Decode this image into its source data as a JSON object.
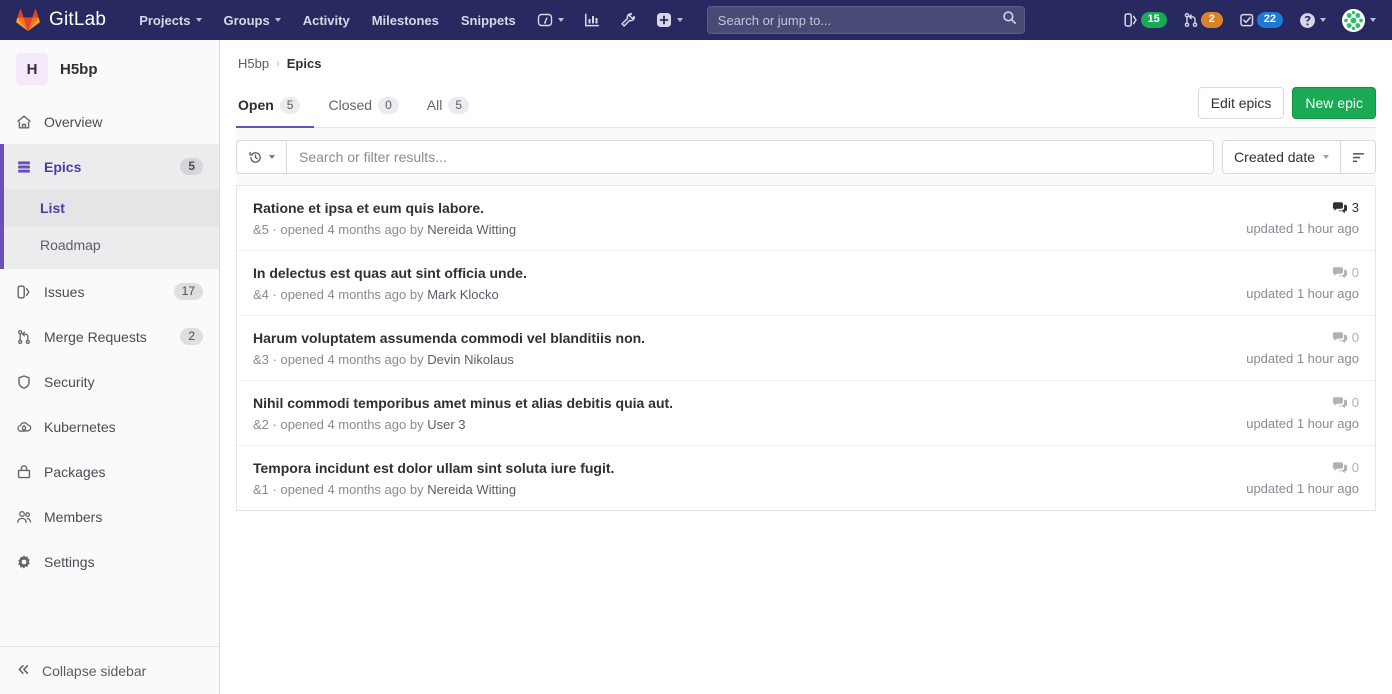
{
  "navbar": {
    "brand": "GitLab",
    "links": [
      {
        "label": "Projects",
        "has_caret": true
      },
      {
        "label": "Groups",
        "has_caret": true
      },
      {
        "label": "Activity",
        "has_caret": false
      },
      {
        "label": "Milestones",
        "has_caret": false
      },
      {
        "label": "Snippets",
        "has_caret": false
      }
    ],
    "icon_buttons": [
      {
        "name": "dashboard-icon",
        "has_caret": true
      },
      {
        "name": "analytics-icon",
        "has_caret": false
      },
      {
        "name": "admin-wrench-icon",
        "has_caret": false
      }
    ],
    "create_new": {
      "name": "plus-square-icon",
      "has_caret": true
    },
    "search": {
      "placeholder": "Search or jump to...",
      "value": ""
    },
    "counters": [
      {
        "name": "issues-counter",
        "icon": "issues-icon",
        "count": "15",
        "color": "#1aaa55"
      },
      {
        "name": "merge-requests-counter",
        "icon": "merge-request-icon",
        "count": "2",
        "color": "#d9822b"
      },
      {
        "name": "todos-counter",
        "icon": "todo-check-icon",
        "count": "22",
        "color": "#1f78d1"
      }
    ],
    "help": {
      "name": "help-icon"
    },
    "user": {
      "name": "user-avatar"
    }
  },
  "sidebar": {
    "group": {
      "initial": "H",
      "name": "H5bp"
    },
    "items": [
      {
        "label": "Overview",
        "icon": "home-icon",
        "count": "",
        "active": false
      },
      {
        "label": "Epics",
        "icon": "epic-icon",
        "count": "5",
        "active": true
      },
      {
        "label": "Issues",
        "icon": "issues-icon",
        "count": "17",
        "active": false
      },
      {
        "label": "Merge Requests",
        "icon": "merge-request-icon",
        "count": "2",
        "active": false
      },
      {
        "label": "Security",
        "icon": "shield-icon",
        "count": "",
        "active": false
      },
      {
        "label": "Kubernetes",
        "icon": "kubernetes-icon",
        "count": "",
        "active": false
      },
      {
        "label": "Packages",
        "icon": "package-icon",
        "count": "",
        "active": false
      },
      {
        "label": "Members",
        "icon": "members-icon",
        "count": "",
        "active": false
      },
      {
        "label": "Settings",
        "icon": "gear-icon",
        "count": "",
        "active": false
      }
    ],
    "epics_subitems": [
      {
        "label": "List",
        "current": true
      },
      {
        "label": "Roadmap",
        "current": false
      }
    ],
    "collapse": {
      "label": "Collapse sidebar",
      "icon": "double-chevron-left-icon"
    }
  },
  "breadcrumb": {
    "group": "H5bp",
    "separator": "›",
    "current": "Epics"
  },
  "tabs": [
    {
      "label": "Open",
      "count": "5",
      "active": true
    },
    {
      "label": "Closed",
      "count": "0",
      "active": false
    },
    {
      "label": "All",
      "count": "5",
      "active": false
    }
  ],
  "actions": {
    "edit_epics": "Edit epics",
    "new_epic": "New epic"
  },
  "filters": {
    "history_icon": "recent-searches-icon",
    "placeholder": "Search or filter results...",
    "value": "",
    "sort_label": "Created date",
    "sort_direction_icon": "sort-descending-icon"
  },
  "epics": [
    {
      "title": "Ratione et ipsa et eum quis labore.",
      "reference": "&5",
      "opened": "· opened 4 months ago by",
      "author": "Nereida Witting",
      "comments": "3",
      "updated": "updated 1 hour ago"
    },
    {
      "title": "In delectus est quas aut sint officia unde.",
      "reference": "&4",
      "opened": "· opened 4 months ago by",
      "author": "Mark Klocko",
      "comments": "0",
      "updated": "updated 1 hour ago"
    },
    {
      "title": "Harum voluptatem assumenda commodi vel blanditiis non.",
      "reference": "&3",
      "opened": "· opened 4 months ago by",
      "author": "Devin Nikolaus",
      "comments": "0",
      "updated": "updated 1 hour ago"
    },
    {
      "title": "Nihil commodi temporibus amet minus et alias debitis quia aut.",
      "reference": "&2",
      "opened": "· opened 4 months ago by",
      "author": "User 3",
      "comments": "0",
      "updated": "updated 1 hour ago"
    },
    {
      "title": "Tempora incidunt est dolor ullam sint soluta iure fugit.",
      "reference": "&1",
      "opened": "· opened 4 months ago by",
      "author": "Nereida Witting",
      "comments": "0",
      "updated": "updated 1 hour ago"
    }
  ],
  "colors": {
    "navbar_bg": "#292961",
    "accent_purple": "#6b4fbb",
    "primary_green": "#1aaa55"
  }
}
